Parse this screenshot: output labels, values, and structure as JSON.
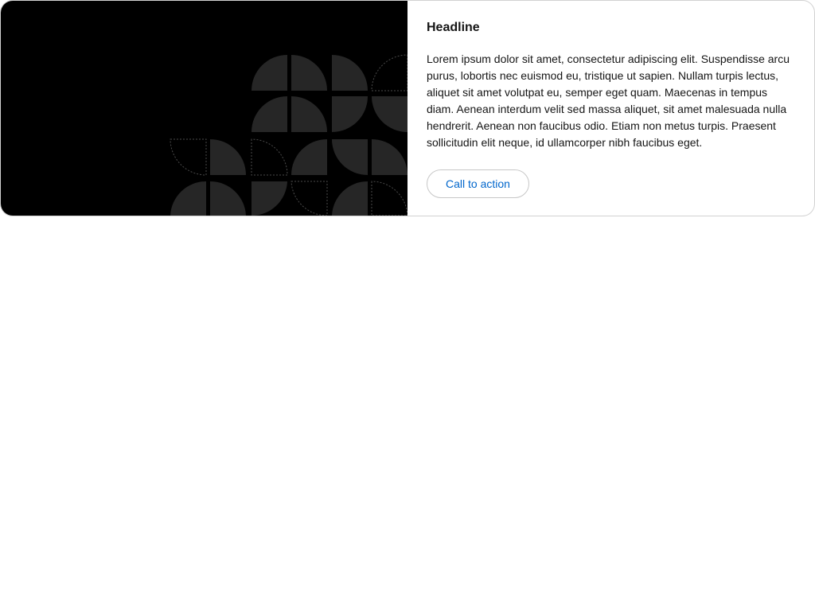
{
  "card": {
    "headline": "Headline",
    "body": "Lorem ipsum dolor sit amet, consectetur adipiscing elit. Suspendisse arcu purus, lobortis nec euismod eu, tristique ut sapien. Nullam turpis lectus, aliquet sit amet volutpat eu, semper eget quam. Maecenas in tempus diam. Aenean interdum velit sed massa aliquet, sit amet malesuada nulla hendrerit. Aenean non faucibus odio. Etiam non metus turpis. Praesent sollicitudin elit neque, id ullamcorper nibh faucibus eget.",
    "cta_label": "Call to action"
  },
  "colors": {
    "image_background": "#000000",
    "pattern_fill": "#262626",
    "pattern_outline": "#4a4a4a",
    "cta_text": "#0066cc",
    "border": "#d2d2d2"
  }
}
